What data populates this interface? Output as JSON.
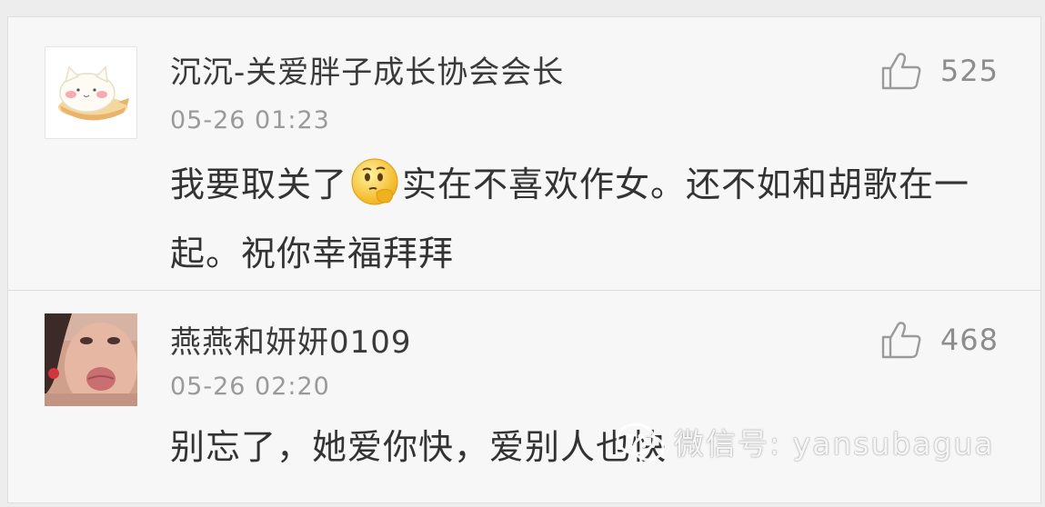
{
  "comments": [
    {
      "username": "沉沉-关爱胖子成长协会会长",
      "timestamp": "05-26 01:23",
      "like_count": "525",
      "text_before_emoji": "我要取关了",
      "emoji_icon": "thinking-face-emoji",
      "text_after_emoji": "实在不喜欢作女。还不如和胡歌在一起。祝你幸福拜拜",
      "avatar_icon": "cartoon-cat-avatar"
    },
    {
      "username": "燕燕和妍妍0109",
      "timestamp": "05-26 02:20",
      "like_count": "468",
      "text": "别忘了，她爱你快，爱别人也快",
      "avatar_icon": "girl-photo-avatar"
    }
  ],
  "watermark": {
    "icon": "wechat-icon",
    "text": "微信号: yansubagua"
  },
  "colors": {
    "background": "#f7f7f7",
    "username": "#3a3a3a",
    "timestamp": "#9a9a9a",
    "like": "#8d8d8d",
    "body": "#333333"
  }
}
